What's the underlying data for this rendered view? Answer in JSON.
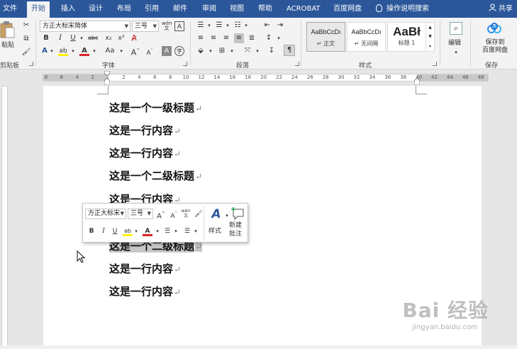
{
  "tabs": [
    {
      "label": "文件"
    },
    {
      "label": "开始"
    },
    {
      "label": "插入"
    },
    {
      "label": "设计"
    },
    {
      "label": "布局"
    },
    {
      "label": "引用"
    },
    {
      "label": "邮件"
    },
    {
      "label": "审阅"
    },
    {
      "label": "视图"
    },
    {
      "label": "帮助"
    },
    {
      "label": "ACROBAT"
    },
    {
      "label": "百度网盘"
    }
  ],
  "tell_me": "操作说明搜索",
  "share": "共享",
  "ribbon": {
    "clipboard": {
      "paste": "粘贴",
      "label": "剪贴板"
    },
    "font": {
      "name": "方正大标宋简体",
      "size": "三号",
      "label": "字体"
    },
    "paragraph": {
      "label": "段落"
    },
    "styles": {
      "label": "样式",
      "items": [
        {
          "preview": "AaBbCcDı",
          "name": "正文"
        },
        {
          "preview": "AaBbCcDı",
          "name": "无间隔"
        },
        {
          "preview": "AaBł",
          "name": "标题 1"
        }
      ]
    },
    "editing": {
      "label": "编辑"
    },
    "save": {
      "button": "保存到\n百度网盘",
      "line1": "保存到",
      "line2": "百度网盘",
      "label": "保存"
    }
  },
  "ruler": {
    "ticks": [
      "8",
      "6",
      "4",
      "2",
      "",
      "2",
      "4",
      "6",
      "8",
      "10",
      "12",
      "14",
      "16",
      "18",
      "20",
      "22",
      "24",
      "26",
      "28",
      "30",
      "32",
      "34",
      "36",
      "38",
      "40",
      "42",
      "44",
      "46",
      "48"
    ]
  },
  "document": {
    "lines": [
      {
        "text": "这是一个一级标题"
      },
      {
        "text": "这是一行内容"
      },
      {
        "text": "这是一行内容"
      },
      {
        "text": "这是一个二级标题"
      },
      {
        "text": "这是一行内容"
      },
      {
        "text": "这是一个二级标题"
      },
      {
        "text": "这是一行内容"
      },
      {
        "text": "这是一行内容"
      }
    ],
    "paragraph_mark": "↵"
  },
  "mini_toolbar": {
    "font": "方正大标宋",
    "size": "三号",
    "styles_label": "样式",
    "new_comment_line1": "新建",
    "new_comment_line2": "批注"
  },
  "watermark": {
    "main": "Bai 经验",
    "sub": "jingyan.baidu.com"
  },
  "colors": {
    "accent": "#2b579a",
    "font_color": "#d9262b",
    "highlight": "#fff200"
  }
}
